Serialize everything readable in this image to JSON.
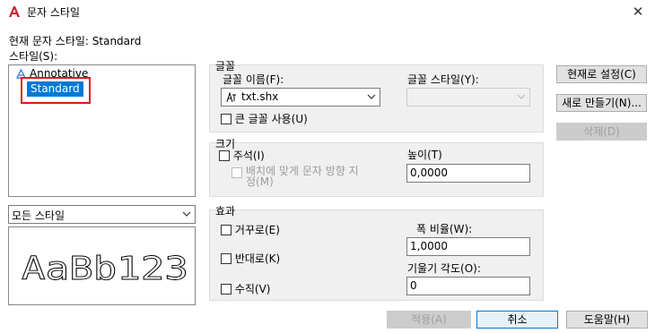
{
  "window": {
    "title": "문자 스타일",
    "close_symbol": "✕"
  },
  "current_style": {
    "label": "현재 문자 스타일: Standard"
  },
  "styles": {
    "label": "스타일(S):",
    "items": [
      "Annotative",
      "Standard"
    ],
    "selected_index": 1
  },
  "filter": {
    "value": "모든 스타일"
  },
  "preview": {
    "sample_text": "AaBb123"
  },
  "font": {
    "group_title": "글꼴",
    "font_name_label": "글꼴 이름(F):",
    "font_name_value": "txt.shx",
    "font_style_label": "글꼴 스타일(Y):",
    "font_style_value": "",
    "use_big_font_label": "큰 글꼴 사용(U)"
  },
  "size": {
    "group_title": "크기",
    "annotative_label": "주석(I)",
    "match_orientation_label": "배치에 맞게 문자 방향 지정(M)",
    "height_label": "높이(T)",
    "height_value": "0,0000"
  },
  "effects": {
    "group_title": "효과",
    "upside_down_label": "거꾸로(E)",
    "backwards_label": "반대로(K)",
    "vertical_label": "수직(V)",
    "width_factor_label": "폭 비율(W):",
    "width_factor_value": "1,0000",
    "oblique_angle_label": "기울기 각도(O):",
    "oblique_angle_value": "0"
  },
  "side_buttons": {
    "set_current": "현재로 설정(C)",
    "new": "새로 만들기(N)...",
    "delete": "삭제(D)"
  },
  "bottom_buttons": {
    "apply": "적용(A)",
    "cancel": "취소",
    "help": "도움말(H)"
  },
  "colors": {
    "selection": "#0078d7",
    "highlight_box": "#e81123",
    "app_icon": "#c1272d"
  }
}
